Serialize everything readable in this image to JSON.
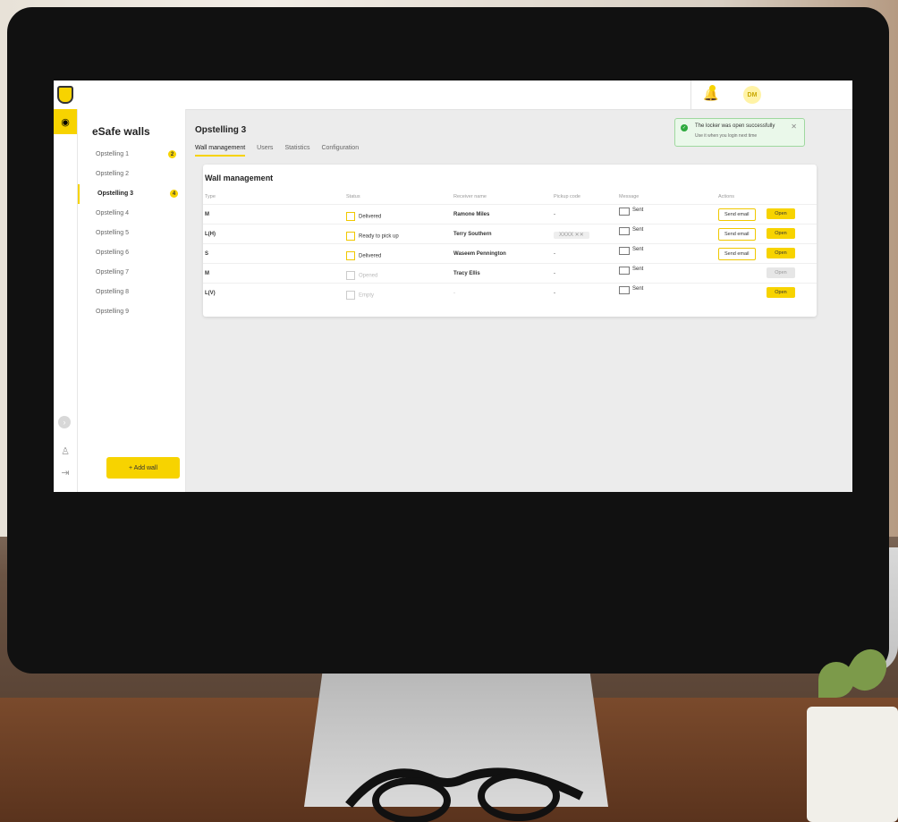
{
  "app": {
    "logo": "shield-icon",
    "user_initials": "DM",
    "notification": "bell-icon"
  },
  "sidebar": {
    "title": "eSafe walls",
    "items": [
      {
        "label": "Opstelling 1",
        "badge": "2",
        "active": false
      },
      {
        "label": "Opstelling 2",
        "badge": "",
        "active": false
      },
      {
        "label": "Opstelling 3",
        "badge": "4",
        "active": true
      },
      {
        "label": "Opstelling 4",
        "badge": "",
        "active": false
      },
      {
        "label": "Opstelling 5",
        "badge": "",
        "active": false
      },
      {
        "label": "Opstelling 6",
        "badge": "",
        "active": false
      },
      {
        "label": "Opstelling 7",
        "badge": "",
        "active": false
      },
      {
        "label": "Opstelling 8",
        "badge": "",
        "active": false
      },
      {
        "label": "Opstelling 9",
        "badge": "",
        "active": false
      }
    ],
    "add_button": "+ Add wall"
  },
  "main": {
    "title": "Opstelling 3",
    "tabs": [
      "Wall management",
      "Users",
      "Statistics",
      "Configuration"
    ],
    "card_title": "Wall management",
    "columns": [
      "Type",
      "Status",
      "Receiver name",
      "Pickup code",
      "Message",
      "Actions"
    ],
    "rows": [
      {
        "type": "M",
        "status": "Delivered",
        "receiver": "Ramone Miles",
        "pickup": "-",
        "message": "Sent",
        "send": "Send email",
        "open": "Open"
      },
      {
        "type": "L(H)",
        "status": "Ready to pick up",
        "receiver": "Terry Southern",
        "pickup": "XXXX ✕✕",
        "message": "Sent",
        "send": "Send email",
        "open": "Open"
      },
      {
        "type": "S",
        "status": "Delivered",
        "receiver": "Waseem Pennington",
        "pickup": "-",
        "message": "Sent",
        "send": "Send email",
        "open": "Open"
      },
      {
        "type": "M",
        "status": "Opened",
        "receiver": "Tracy Ellis",
        "pickup": "-",
        "message": "Sent",
        "send": "",
        "open": "Open"
      },
      {
        "type": "L(V)",
        "status": "Empty",
        "receiver": "-",
        "pickup": "-",
        "message": "Sent",
        "send": "",
        "open": "Open"
      }
    ]
  },
  "toast": {
    "title": "The locker was open successfully",
    "subtitle": "Use it when you login next time"
  }
}
